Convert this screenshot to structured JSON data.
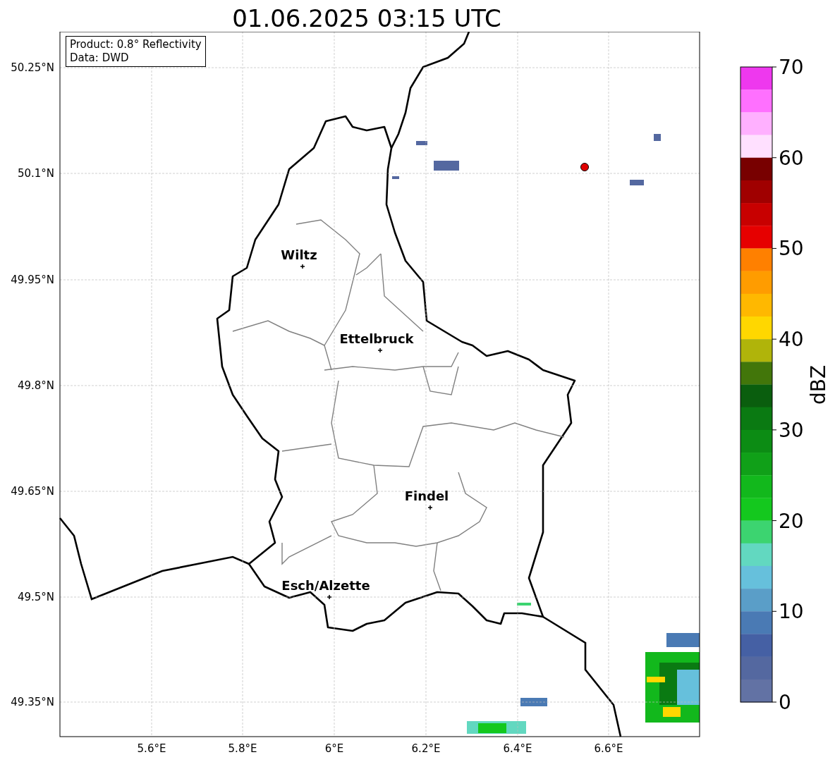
{
  "title": "01.06.2025 03:15 UTC",
  "info_box": [
    "Product: 0.8° Reflectivity",
    "Data: DWD"
  ],
  "y_ticks": [
    "50.25°N",
    "50.1°N",
    "49.95°N",
    "49.8°N",
    "49.65°N",
    "49.5°N",
    "49.35°N"
  ],
  "x_ticks": [
    "5.6°E",
    "5.8°E",
    "6°E",
    "6.2°E",
    "6.4°E",
    "6.6°E"
  ],
  "cities": [
    {
      "name": "Wiltz"
    },
    {
      "name": "Ettelbruck"
    },
    {
      "name": "Findel"
    },
    {
      "name": "Esch/Alzette"
    }
  ],
  "colorbar": {
    "label": "dBZ",
    "ticks": [
      "70",
      "60",
      "50",
      "40",
      "30",
      "20",
      "10",
      "0"
    ],
    "bins": [
      {
        "color": "#ee38ee"
      },
      {
        "color": "#ff70ff"
      },
      {
        "color": "#ffb0ff"
      },
      {
        "color": "#ffe0ff"
      },
      {
        "color": "#780000"
      },
      {
        "color": "#a00000"
      },
      {
        "color": "#c80000"
      },
      {
        "color": "#e60000"
      },
      {
        "color": "#ff8000"
      },
      {
        "color": "#ff9c00"
      },
      {
        "color": "#ffb800"
      },
      {
        "color": "#ffd700"
      },
      {
        "color": "#b0b40a"
      },
      {
        "color": "#42760a"
      },
      {
        "color": "#0a5e0e"
      },
      {
        "color": "#0a7a12"
      },
      {
        "color": "#0c8c14"
      },
      {
        "color": "#10a018"
      },
      {
        "color": "#12b81c"
      },
      {
        "color": "#14c81e"
      },
      {
        "color": "#3cd470"
      },
      {
        "color": "#62d8c0"
      },
      {
        "color": "#66c0dc"
      },
      {
        "color": "#5a9ec8"
      },
      {
        "color": "#4a7ab4"
      },
      {
        "color": "#4560a4"
      },
      {
        "color": "#5468a0"
      },
      {
        "color": "#6272a4"
      }
    ]
  }
}
